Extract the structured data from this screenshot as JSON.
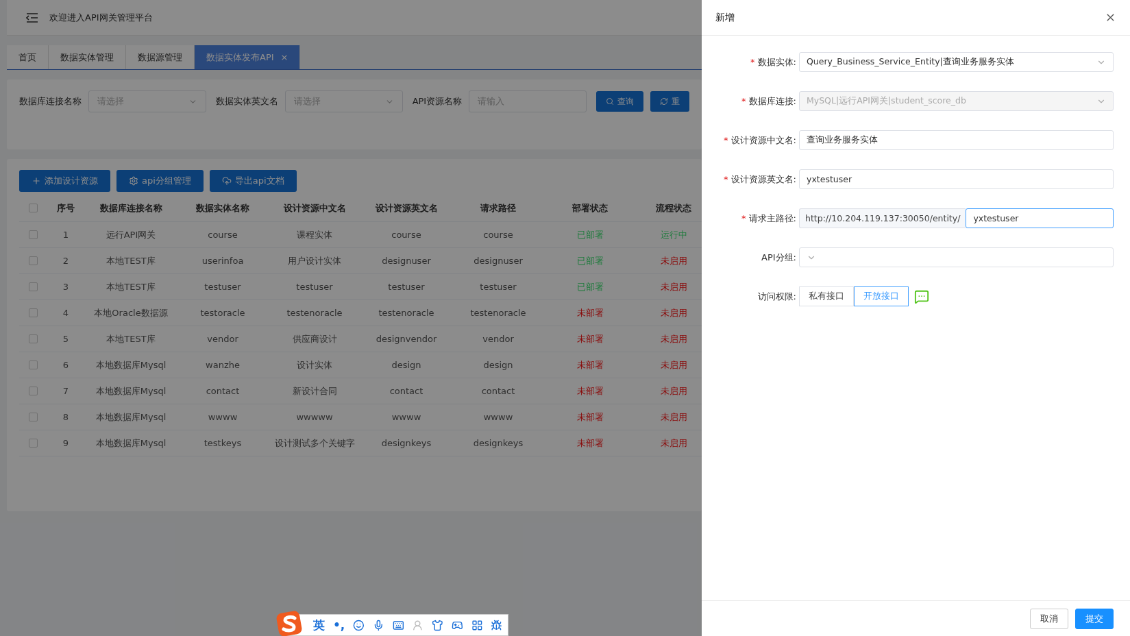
{
  "header": {
    "title": "欢迎进入API网关管理平台"
  },
  "tabs": [
    {
      "label": "首页",
      "selected": false
    },
    {
      "label": "数据实体管理",
      "selected": false
    },
    {
      "label": "数据源管理",
      "selected": false
    },
    {
      "label": "数据实体发布API",
      "selected": true,
      "close": "×"
    }
  ],
  "filters": [
    {
      "kind": "select",
      "label": "数据库连接名称",
      "placeholder": "请选择"
    },
    {
      "kind": "select",
      "label": "数据实体英文名",
      "placeholder": "请选择"
    },
    {
      "kind": "input",
      "label": "API资源名称",
      "placeholder": "请输入"
    }
  ],
  "filter_buttons": [
    {
      "kind": "search",
      "label": "查询"
    },
    {
      "kind": "reset",
      "label": "重"
    }
  ],
  "toolbar": [
    {
      "kind": "plus",
      "label": "添加设计资源"
    },
    {
      "kind": "gear",
      "label": "api分组管理"
    },
    {
      "kind": "cloud",
      "label": "导出api文档"
    }
  ],
  "table": {
    "all_checked": false,
    "columns": [
      "序号",
      "数据库连接名称",
      "数据实体名称",
      "设计资源中文名",
      "设计资源英文名",
      "请求路径",
      "部署状态",
      "流程状态"
    ],
    "rows": [
      {
        "checked": false,
        "cells": [
          "1",
          "远行API网关",
          "course",
          "课程实体",
          "course",
          "course"
        ],
        "deploy": {
          "text": "已部署",
          "color": "#1e7b3c"
        },
        "flow": {
          "text": "运行中",
          "color": "#1e7b3c"
        }
      },
      {
        "checked": false,
        "cells": [
          "2",
          "本地TEST库",
          "userinfoa",
          "用户设计实体",
          "designuser",
          "designuser"
        ],
        "deploy": {
          "text": "已部署",
          "color": "#1e7b3c"
        },
        "flow": {
          "text": "未启用",
          "color": "#8a0a0a"
        }
      },
      {
        "checked": false,
        "cells": [
          "3",
          "本地TEST库",
          "testuser",
          "testuser",
          "testuser",
          "testuser"
        ],
        "deploy": {
          "text": "已部署",
          "color": "#1e7b3c"
        },
        "flow": {
          "text": "未启用",
          "color": "#8a0a0a"
        }
      },
      {
        "checked": false,
        "cells": [
          "4",
          "本地Oracle数据源",
          "testoracle",
          "testenoracle",
          "testenoracle",
          "testenoracle"
        ],
        "deploy": {
          "text": "未部署",
          "color": "#8a0a0a"
        },
        "flow": {
          "text": "未启用",
          "color": "#8a0a0a"
        }
      },
      {
        "checked": false,
        "cells": [
          "5",
          "本地TEST库",
          "vendor",
          "供应商设计",
          "designvendor",
          "vendor"
        ],
        "deploy": {
          "text": "未部署",
          "color": "#8a0a0a"
        },
        "flow": {
          "text": "未启用",
          "color": "#8a0a0a"
        }
      },
      {
        "checked": false,
        "cells": [
          "6",
          "本地数据库Mysql",
          "wanzhe",
          "设计实体",
          "design",
          "design"
        ],
        "deploy": {
          "text": "未部署",
          "color": "#8a0a0a"
        },
        "flow": {
          "text": "未启用",
          "color": "#8a0a0a"
        }
      },
      {
        "checked": false,
        "cells": [
          "7",
          "本地数据库Mysql",
          "contact",
          "新设计合同",
          "contact",
          "contact"
        ],
        "deploy": {
          "text": "未部署",
          "color": "#8a0a0a"
        },
        "flow": {
          "text": "未启用",
          "color": "#8a0a0a"
        }
      },
      {
        "checked": false,
        "cells": [
          "8",
          "本地数据库Mysql",
          "wwww",
          "wwwww",
          "wwww",
          "wwww"
        ],
        "deploy": {
          "text": "未部署",
          "color": "#8a0a0a"
        },
        "flow": {
          "text": "未启用",
          "color": "#8a0a0a"
        }
      },
      {
        "checked": false,
        "cells": [
          "9",
          "本地数据库Mysql",
          "testkeys",
          "设计测试多个关键字",
          "designkeys",
          "designkeys"
        ],
        "deploy": {
          "text": "未部署",
          "color": "#8a0a0a"
        },
        "flow": {
          "text": "未启用",
          "color": "#8a0a0a"
        }
      }
    ]
  },
  "drawer": {
    "title": "新增",
    "fields": [
      {
        "kind": "select",
        "mark": "*",
        "label": "数据实体:",
        "value": "Query_Business_Service_Entity|查询业务服务实体"
      },
      {
        "kind": "select",
        "mark": "*",
        "label": "数据库连接:",
        "disabled": true,
        "value": "MySQL|远行API网关|student_score_db"
      },
      {
        "kind": "input",
        "mark": "*",
        "label": "设计资源中文名:",
        "value": "查询业务服务实体"
      },
      {
        "kind": "input",
        "mark": "*",
        "label": "设计资源英文名:",
        "value": "yxtestuser"
      },
      {
        "kind": "prefixed",
        "mark": "*",
        "label": "请求主路径:",
        "prefix": "http://10.204.119.137:30050/entity/",
        "value": "yxtestuser",
        "focused": true
      },
      {
        "kind": "select",
        "label": "API分组:"
      },
      {
        "kind": "radio",
        "label": "访问权限:",
        "options": [
          {
            "label": "私有接口",
            "selected": false
          },
          {
            "label": "开放接口",
            "selected": true
          }
        ]
      }
    ],
    "footer": [
      {
        "label": "取消",
        "primary": false
      },
      {
        "label": "提交",
        "primary": true
      }
    ]
  },
  "ime": {
    "language": "英",
    "punctuation": "•,"
  }
}
